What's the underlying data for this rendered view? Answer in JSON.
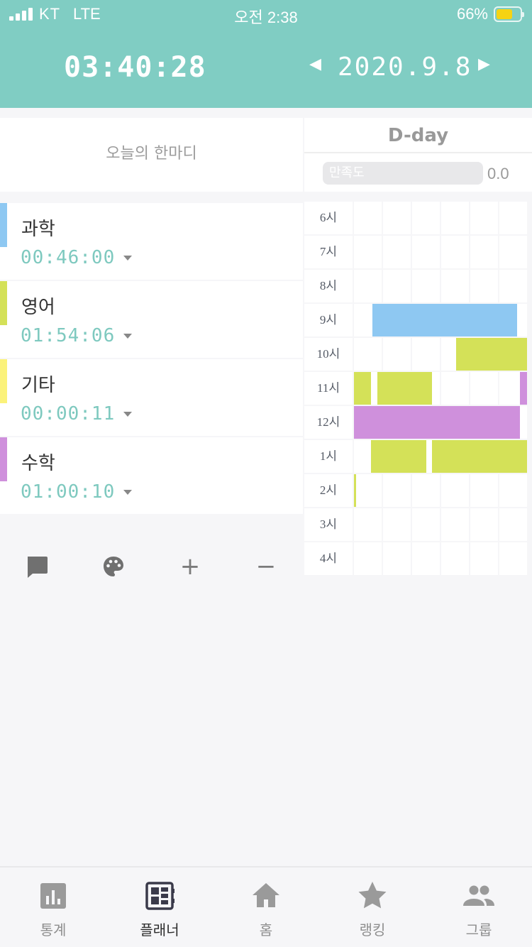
{
  "status_bar": {
    "carrier": "KT",
    "network": "LTE",
    "time": "오전 2:38",
    "battery": "66%"
  },
  "header": {
    "timer": "03:40:28",
    "date": "2020.9.8"
  },
  "quote": {
    "placeholder": "오늘의 한마디"
  },
  "dday": {
    "label": "D-day",
    "satisfaction_label": "만족도",
    "satisfaction_value": "0.0"
  },
  "subjects": [
    {
      "name": "과학",
      "time": "00:46:00",
      "color": "#8ec8f2"
    },
    {
      "name": "영어",
      "time": "01:54:06",
      "color": "#d4e158"
    },
    {
      "name": "기타",
      "time": "00:00:11",
      "color": "#fbf27a"
    },
    {
      "name": "수학",
      "time": "01:00:10",
      "color": "#cf90dc"
    }
  ],
  "timetable": {
    "hours": [
      "6시",
      "7시",
      "8시",
      "9시",
      "10시",
      "11시",
      "12시",
      "1시",
      "2시",
      "3시",
      "4시"
    ],
    "blocks": [
      {
        "hour": 3,
        "start_min": 6.5,
        "end_min": 56.5,
        "color": "#8ec8f2"
      },
      {
        "hour": 4,
        "start_min": 35.5,
        "end_min": 60,
        "color": "#d4e158"
      },
      {
        "hour": 5,
        "start_min": 0,
        "end_min": 6,
        "color": "#d4e158"
      },
      {
        "hour": 5,
        "start_min": 8,
        "end_min": 27,
        "color": "#d4e158"
      },
      {
        "hour": 5,
        "start_min": 57.5,
        "end_min": 60,
        "color": "#cf90dc"
      },
      {
        "hour": 6,
        "start_min": 0,
        "end_min": 57.5,
        "color": "#cf90dc"
      },
      {
        "hour": 7,
        "start_min": 6,
        "end_min": 25,
        "color": "#d4e158"
      },
      {
        "hour": 7,
        "start_min": 27,
        "end_min": 60,
        "color": "#d4e158"
      },
      {
        "hour": 8,
        "start_min": 0,
        "end_min": 0.7,
        "color": "#d4e158"
      }
    ]
  },
  "toolbar": {
    "icons": [
      "comment-icon",
      "palette-icon",
      "plus-icon",
      "minus-icon"
    ],
    "plus": "+",
    "minus": "−"
  },
  "tabbar": {
    "items": [
      {
        "label": "통계",
        "icon": "stats-icon"
      },
      {
        "label": "플래너",
        "icon": "planner-icon",
        "active": true
      },
      {
        "label": "홈",
        "icon": "home-icon"
      },
      {
        "label": "랭킹",
        "icon": "star-icon"
      },
      {
        "label": "그룹",
        "icon": "group-icon"
      }
    ]
  }
}
